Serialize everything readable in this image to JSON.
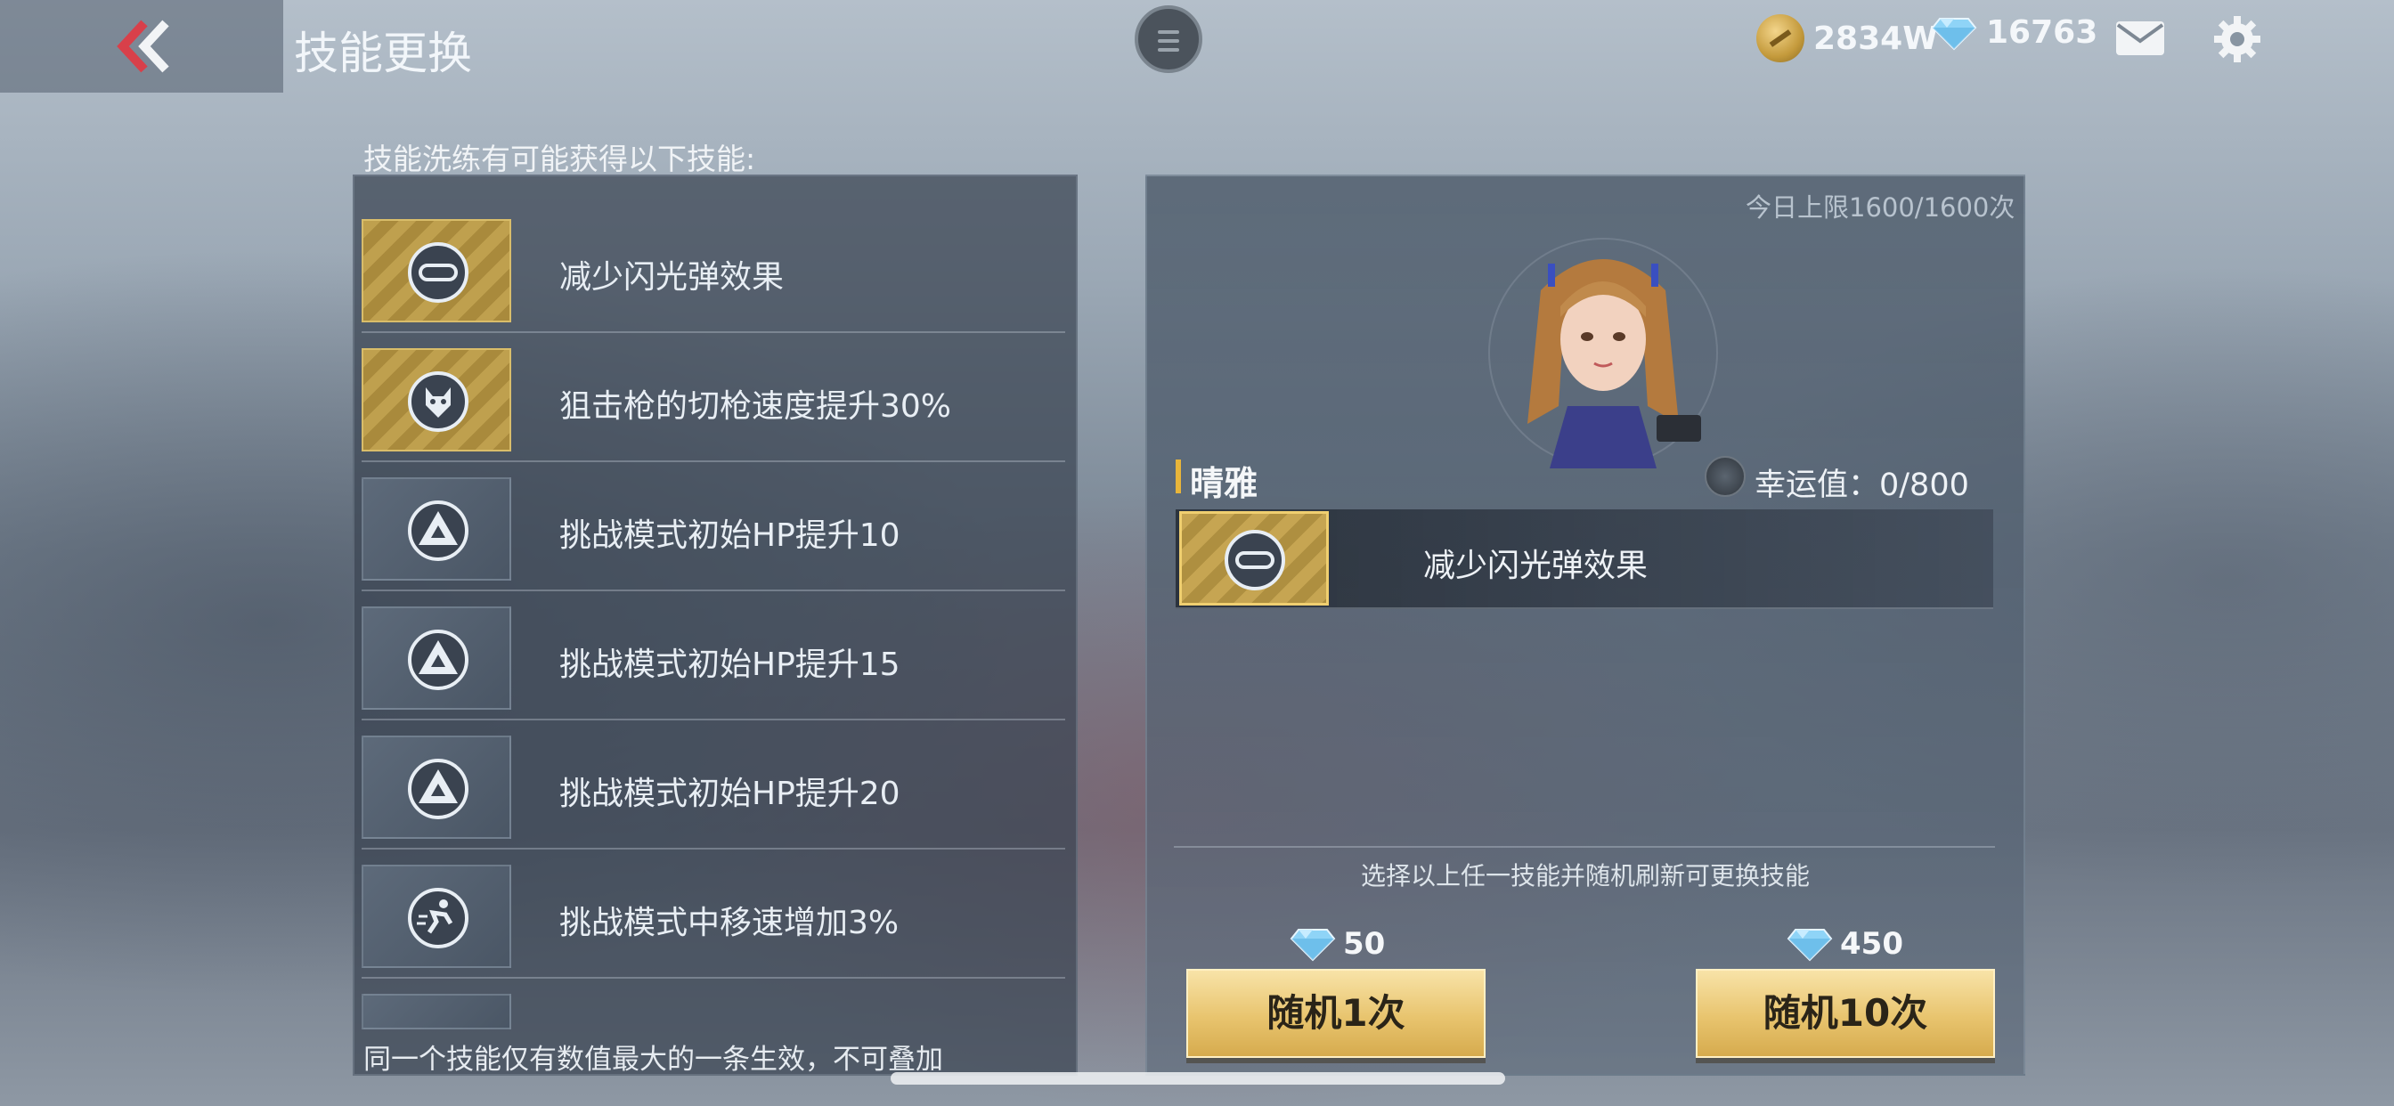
{
  "header": {
    "title": "技能更换",
    "gold": "2834W",
    "diamonds": "16763"
  },
  "left": {
    "heading": "技能洗练有可能获得以下技能:",
    "skills": [
      {
        "label": "减少闪光弹效果",
        "icon": "goggles-icon",
        "tier": "gold"
      },
      {
        "label": "狙击枪的切枪速度提升30%",
        "icon": "wolf-emblem-icon",
        "tier": "gold"
      },
      {
        "label": "挑战模式初始HP提升10",
        "icon": "triangle-emblem-icon",
        "tier": "normal"
      },
      {
        "label": "挑战模式初始HP提升15",
        "icon": "triangle-emblem-icon",
        "tier": "normal"
      },
      {
        "label": "挑战模式初始HP提升20",
        "icon": "triangle-emblem-icon",
        "tier": "normal"
      },
      {
        "label": "挑战模式中移速增加3%",
        "icon": "running-man-icon",
        "tier": "normal"
      }
    ],
    "footnote": "同一个技能仅有数值最大的一条生效，不可叠加"
  },
  "right": {
    "daily_limit": "今日上限1600/1600次",
    "character_name": "晴雅",
    "luck": "幸运值：0/800",
    "current_skill": "减少闪光弹效果",
    "hint": "选择以上任一技能并随机刷新可更换技能",
    "roll_once": {
      "cost": "50",
      "label": "随机1次"
    },
    "roll_ten": {
      "cost": "450",
      "label": "随机10次"
    }
  },
  "colors": {
    "accent_gold": "#e8c46e",
    "name_bar": "#e8b53a",
    "back_chevron": "#d8404a"
  }
}
